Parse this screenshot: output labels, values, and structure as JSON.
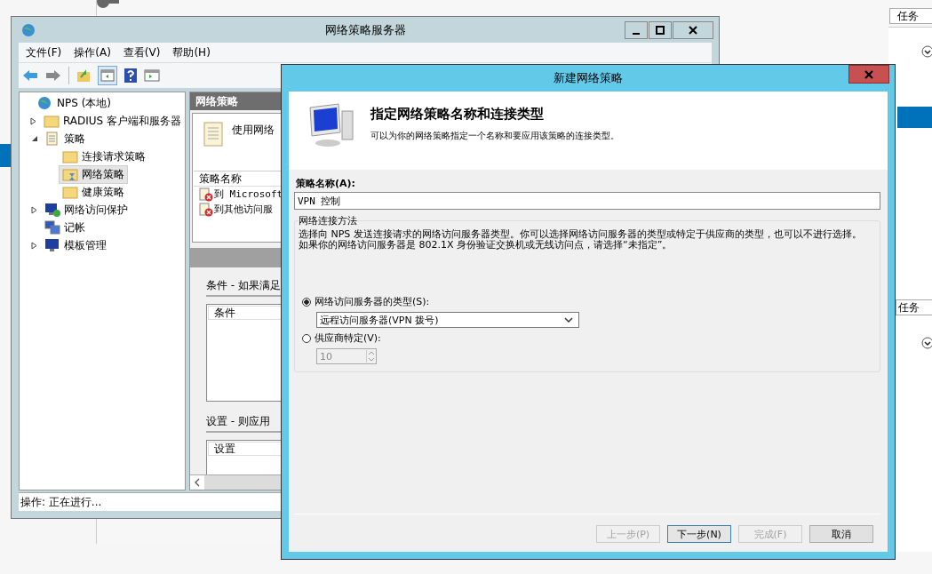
{
  "background": {
    "task_buttons": [
      "任务",
      "任务"
    ]
  },
  "nps_window": {
    "title": "网络策略服务器",
    "menu": [
      "文件(F)",
      "操作(A)",
      "查看(V)",
      "帮助(H)"
    ],
    "tree": [
      {
        "label": "NPS (本地)",
        "kind": "globe",
        "selected": false,
        "children": [
          {
            "label": "RADIUS 客户端和服务器",
            "kind": "folder",
            "expanded": false,
            "selected": false
          },
          {
            "label": "策略",
            "kind": "scroll",
            "expanded": true,
            "selected": false,
            "children": [
              {
                "label": "连接请求策略",
                "kind": "folder",
                "selected": false
              },
              {
                "label": "网络策略",
                "kind": "folder-busy",
                "selected": true
              },
              {
                "label": "健康策略",
                "kind": "folder",
                "selected": false
              }
            ]
          },
          {
            "label": "网络访问保护",
            "kind": "shield-monitor",
            "expanded": false,
            "selected": false
          },
          {
            "label": "记帐",
            "kind": "monitors",
            "selected": false
          },
          {
            "label": "模板管理",
            "kind": "monitor",
            "expanded": false,
            "selected": false
          }
        ]
      }
    ],
    "pane": {
      "header": "网络策略",
      "intro": "使用网络",
      "list_header": "策略名称",
      "rows": [
        {
          "name": "到 Microsoft",
          "enabled": false
        },
        {
          "name": "到其他访问服",
          "enabled": false
        }
      ],
      "conditions_title": "条件 - 如果满足",
      "conditions_header": "条件",
      "settings_title": "设置 - 则应用",
      "settings_header": "设置"
    },
    "status": "操作: 正在进行..."
  },
  "dialog": {
    "title": "新建网络策略",
    "heading": "指定网络策略名称和连接类型",
    "subheading": "可以为你的网络策略指定一个名称和要应用该策略的连接类型。",
    "name_label": "策略名称(A):",
    "name_value": "VPN 控制",
    "group_title": "网络连接方法",
    "description": "选择向 NPS 发送连接请求的网络访问服务器类型。你可以选择网络访问服务器的类型或特定于供应商的类型，也可以不进行选择。如果你的网络访问服务器是 802.1X 身份验证交换机或无线访问点，请选择“未指定”。",
    "options": [
      {
        "label": "网络访问服务器的类型(S):",
        "selected": true,
        "kind": "dropdown",
        "value": "远程访问服务器(VPN 拨号)",
        "disabled": false
      },
      {
        "label": "供应商特定(V):",
        "selected": false,
        "kind": "spinner",
        "value": "10",
        "disabled": true
      }
    ],
    "buttons": [
      {
        "label": "上一步(P)",
        "disabled": true,
        "default": false
      },
      {
        "label": "下一步(N)",
        "disabled": false,
        "default": true
      },
      {
        "label": "完成(F)",
        "disabled": true,
        "default": false
      },
      {
        "label": "取消",
        "disabled": false,
        "default": false
      }
    ]
  }
}
